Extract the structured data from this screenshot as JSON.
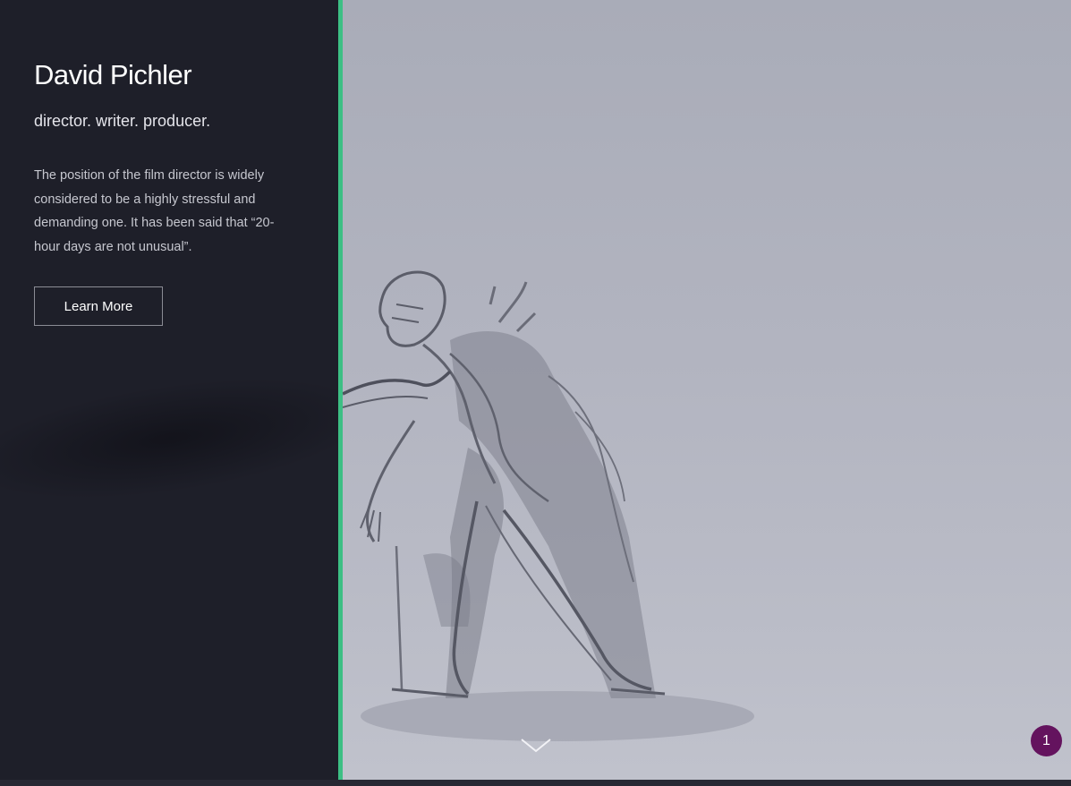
{
  "sidebar": {
    "name": "David Pichler",
    "tagline": "director. writer. producer.",
    "blurb": "The position of the film director is widely considered to be a highly stressful and demanding one. It has been said that “20-hour days are not unusual”.",
    "learn_more_label": "Learn More"
  },
  "hero": {
    "image_subject": "pencil-sketch-figure",
    "scroll_icon": "chevron-down-icon"
  },
  "badge": {
    "count": "1"
  },
  "colors": {
    "sidebar_bg": "#1e1f29",
    "accent_divider": "#3dbf84",
    "badge_bg": "#64135e"
  }
}
